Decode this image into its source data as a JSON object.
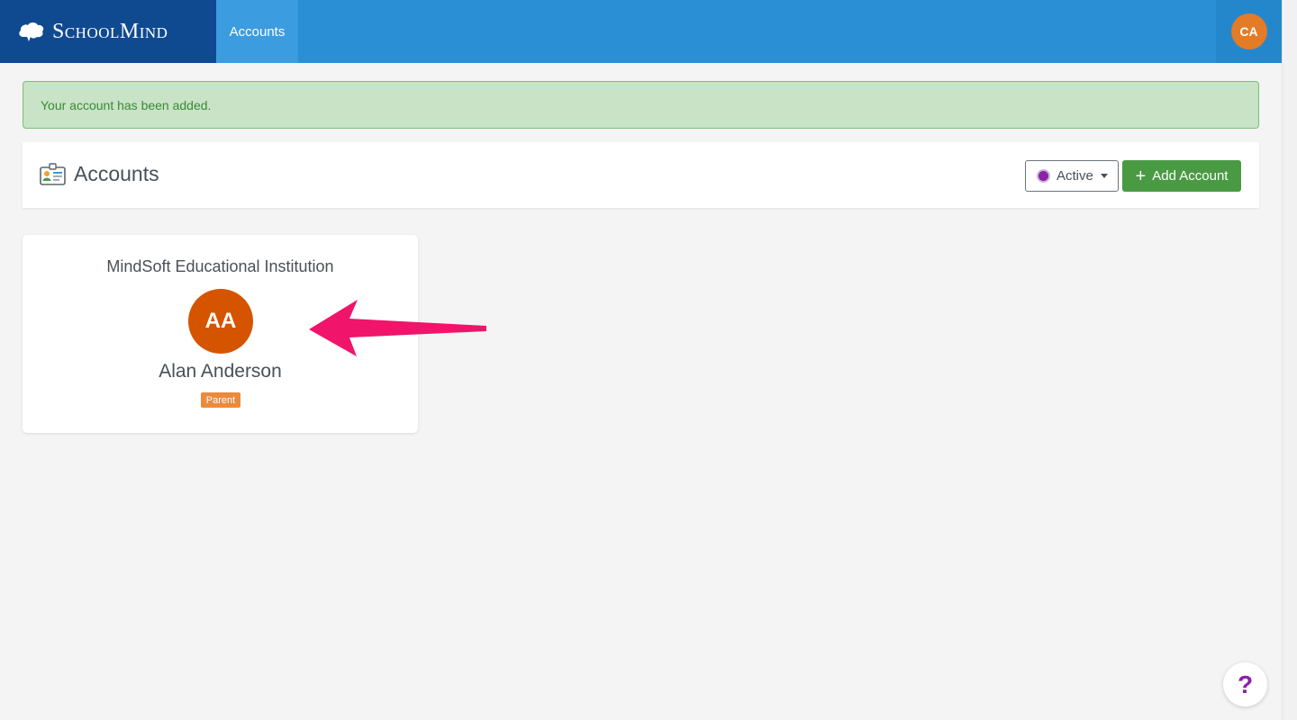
{
  "nav": {
    "brand": "SchoolMind",
    "tab_label": "Accounts",
    "user_initials": "CA"
  },
  "alert": {
    "message": "Your account has been added."
  },
  "header": {
    "title": "Accounts",
    "status_filter": "Active",
    "add_button_label": "Add Account"
  },
  "account_card": {
    "institution": "MindSoft Educational Institution",
    "initials": "AA",
    "name": "Alan Anderson",
    "role": "Parent"
  },
  "help": {
    "label": "?"
  },
  "colors": {
    "brand_dark": "#0f4a91",
    "topbar": "#2a8fd4",
    "success": "#4a9a44",
    "avatar_orange": "#d55400",
    "status_purple": "#8a21a6",
    "arrow": "#f0146a"
  },
  "icons": {
    "brand": "cloud-brain-icon",
    "header": "id-card-icon",
    "plus": "plus-icon",
    "caret": "caret-down-icon",
    "annotation": "pointer-arrow"
  }
}
